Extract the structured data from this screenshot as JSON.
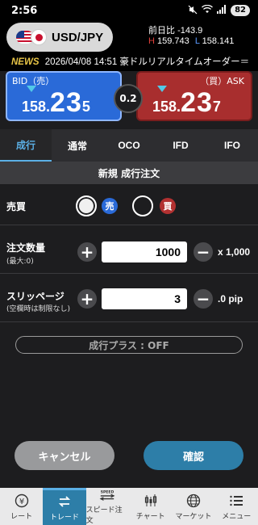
{
  "statusbar": {
    "time": "2:56",
    "battery": "82"
  },
  "header": {
    "pair": "USD/JPY",
    "prev_day_label": "前日比",
    "prev_day_value": "-143.9",
    "high_label": "H",
    "high_value": "159.743",
    "low_label": "L",
    "low_value": "158.141"
  },
  "news": {
    "tag": "NEWS",
    "text": "2026/04/08 14:51 豪ドルリアルタイムオーダー＝"
  },
  "rates": {
    "bid_label": "BID（売）",
    "ask_label": "（買）ASK",
    "bid_base": "158.",
    "bid_big": "23",
    "bid_pip": "5",
    "ask_base": "158.",
    "ask_big": "23",
    "ask_pip": "7",
    "spread": "0.2"
  },
  "tabs": [
    {
      "label": "成行",
      "active": true
    },
    {
      "label": "通常"
    },
    {
      "label": "OCO"
    },
    {
      "label": "IFD"
    },
    {
      "label": "IFO"
    }
  ],
  "order": {
    "title": "新規 成行注文",
    "side_label": "売買",
    "sell_label": "売",
    "buy_label": "買",
    "qty_label": "注文数量",
    "qty_sub": "(最大:0)",
    "qty_value": "1000",
    "qty_unit": "x 1,000",
    "slip_label": "スリッページ",
    "slip_sub": "(空欄時は制限なし)",
    "slip_value": "3",
    "slip_unit": ".0 pip",
    "plus_label": "成行プラス : OFF"
  },
  "actions": {
    "cancel": "キャンセル",
    "confirm": "確認"
  },
  "nav": [
    {
      "label": "レート"
    },
    {
      "label": "トレード",
      "active": true
    },
    {
      "label": "スピード注文"
    },
    {
      "label": "チャート"
    },
    {
      "label": "マーケット"
    },
    {
      "label": "メニュー"
    }
  ],
  "colors": {
    "bid": "#2a6ad8",
    "ask": "#a82e2e",
    "accent": "#2d7ea8",
    "tab_active": "#5bb0e6"
  }
}
